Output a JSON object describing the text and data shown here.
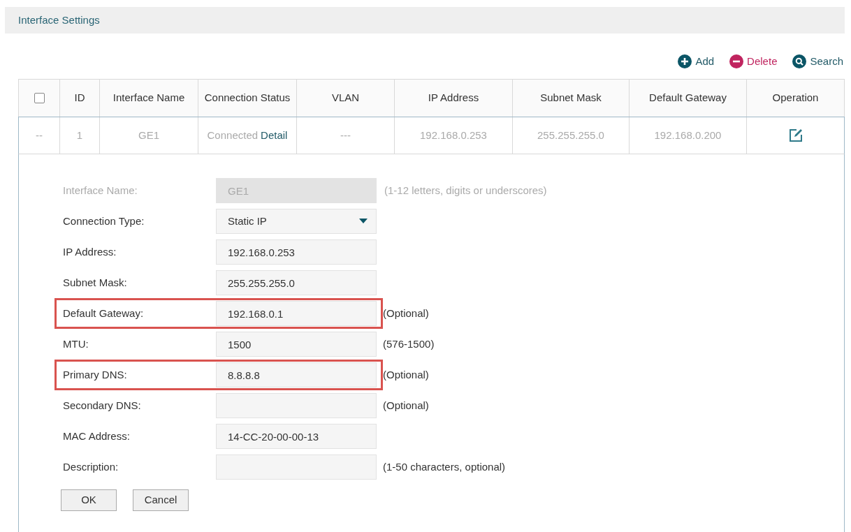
{
  "header": {
    "title": "Interface Settings"
  },
  "toolbar": [
    {
      "kind": "add",
      "label": "Add"
    },
    {
      "kind": "delete",
      "label": "Delete"
    },
    {
      "kind": "search",
      "label": "Search"
    }
  ],
  "table": {
    "select_all": {
      "checked": false
    },
    "columns": [
      "ID",
      "Interface Name",
      "Connection Status",
      "VLAN",
      "IP Address",
      "Subnet Mask",
      "Default Gateway",
      "Operation"
    ],
    "rows": [
      {
        "select": "--",
        "id": "1",
        "name": "GE1",
        "status": "Connected",
        "status_link": "Detail",
        "vlan": "---",
        "ip": "192.168.0.253",
        "mask": "255.255.255.0",
        "gateway": "192.168.0.200"
      }
    ]
  },
  "form": {
    "fields": [
      {
        "label": "Interface Name:",
        "kind": "text",
        "value": "GE1",
        "disabled": true,
        "highlighted": false,
        "hint": "(1-12 letters, digits or underscores)"
      },
      {
        "label": "Connection Type:",
        "kind": "select",
        "value": "Static IP",
        "disabled": false,
        "highlighted": false
      },
      {
        "label": "IP Address:",
        "kind": "text",
        "value": "192.168.0.253",
        "disabled": false,
        "highlighted": false
      },
      {
        "label": "Subnet Mask:",
        "kind": "text",
        "value": "255.255.255.0",
        "disabled": false,
        "highlighted": false
      },
      {
        "label": "Default Gateway:",
        "kind": "text",
        "value": "192.168.0.1",
        "disabled": false,
        "highlighted": true,
        "hint": "(Optional)"
      },
      {
        "label": "MTU:",
        "kind": "text",
        "value": "1500",
        "disabled": false,
        "highlighted": false,
        "hint": "(576-1500)"
      },
      {
        "label": "Primary DNS:",
        "kind": "text",
        "value": "8.8.8.8",
        "disabled": false,
        "highlighted": true,
        "hint": "(Optional)"
      },
      {
        "label": "Secondary DNS:",
        "kind": "text",
        "disabled": false,
        "highlighted": false,
        "hint": "(Optional)"
      },
      {
        "label": "MAC Address:",
        "kind": "text",
        "value": "14-CC-20-00-00-13",
        "disabled": false,
        "highlighted": false
      },
      {
        "label": "Description:",
        "kind": "text",
        "disabled": false,
        "highlighted": false,
        "hint": "(1-50 characters, optional)"
      }
    ],
    "buttons": [
      "OK",
      "Cancel"
    ]
  }
}
